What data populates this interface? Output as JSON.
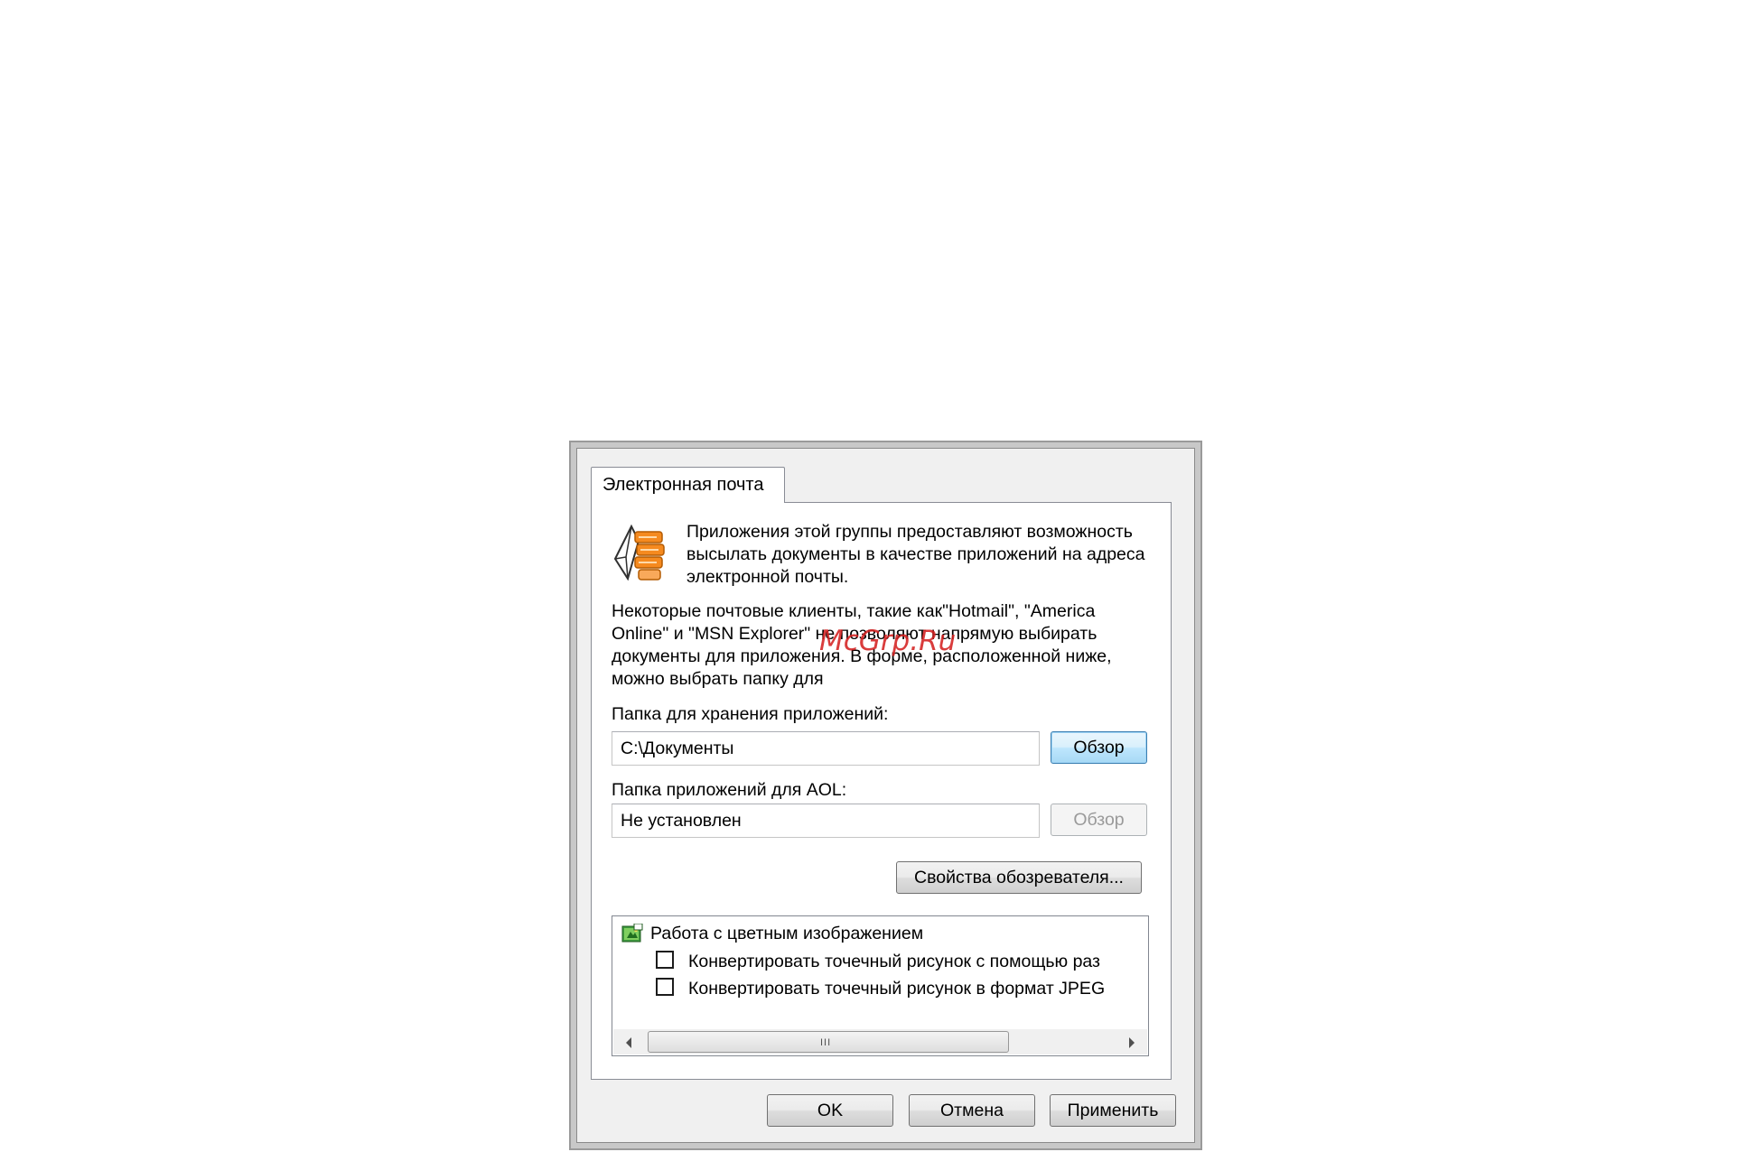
{
  "dialog": {
    "tab_label": "Электронная почта",
    "intro_text": "Приложения этой группы предоставляют возможность высылать документы в качестве приложений на адреса электронной почты.",
    "note_text": "Некоторые почтовые клиенты, такие как\"Hotmail\", \"America Online\" и \"MSN Explorer\" не позволяют напрямую выбирать документы для приложения. В форме, расположенной ниже, можно выбрать папку для",
    "storage_label": "Папка для хранения приложений:",
    "storage_value": "C:\\Документы",
    "browse_label": "Обзор",
    "aol_label": "Папка приложений для AOL:",
    "aol_value": "Не установлен",
    "aol_browse_label": "Обзор",
    "browser_props_label": "Свойства обозревателя...",
    "options": {
      "group_label": "Работа с цветным изображением",
      "items": [
        {
          "label": "Конвертировать точечный рисунок с помощью раз",
          "checked": false
        },
        {
          "label": "Конвертировать точечный рисунок в формат JPEG",
          "checked": false
        }
      ],
      "scroll_grip": "III"
    },
    "buttons": {
      "ok": "OK",
      "cancel": "Отмена",
      "apply": "Применить"
    }
  },
  "watermark": "McGrp.Ru",
  "icons": {
    "mail": "mail-attachment-icon",
    "tree": "color-image-icon"
  }
}
